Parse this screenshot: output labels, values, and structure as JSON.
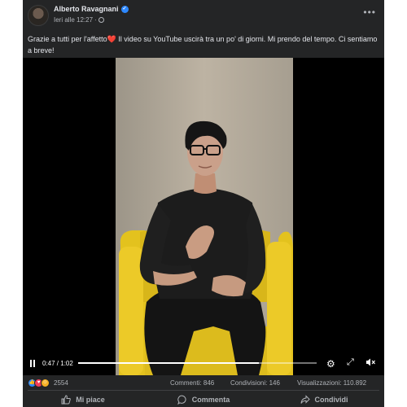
{
  "post": {
    "author": "Alberto Ravagnani",
    "verified_icon": "verified-badge-icon",
    "timestamp": "Ieri alle 12:27",
    "separator": "·",
    "privacy_icon": "globe-icon",
    "more_label": "•••",
    "caption": "Grazie a tutti per l'affetto❤️ Il video su YouTube uscirà tra un po' di giorni. Mi prendo del tempo. Ci sentiamo a breve!"
  },
  "video": {
    "current_time": "0:47",
    "duration": "1:02",
    "time_display": "0:47 / 1:02",
    "progress_fraction": 0.758,
    "controls": [
      "pause-icon",
      "gear-icon",
      "fullscreen-icon",
      "muted-volume-icon"
    ]
  },
  "stats": {
    "reaction_count": "2554",
    "reaction_icons": [
      "like-icon",
      "love-icon",
      "care-icon"
    ],
    "comments": "Commenti: 846",
    "shares": "Condivisioni: 146",
    "views": "Visualizzazioni: 110.892"
  },
  "actions": {
    "like_label": "Mi piace",
    "comment_label": "Commenta",
    "share_label": "Condividi"
  },
  "colors": {
    "card_bg": "#242526",
    "text_primary": "#e4e6eb",
    "text_secondary": "#b0b3b8",
    "accent_blue": "#2d88ff",
    "chair_yellow": "#e3c21e"
  }
}
